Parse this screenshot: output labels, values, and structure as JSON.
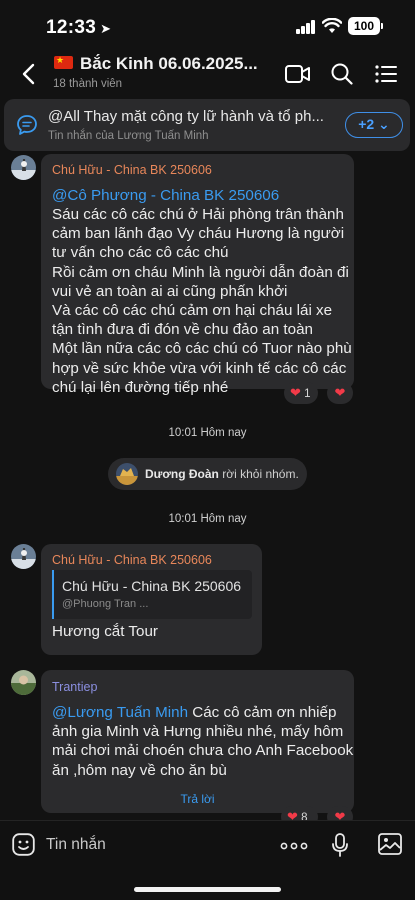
{
  "status_bar": {
    "time": "12:33",
    "battery": "100"
  },
  "header": {
    "title": "Bắc Kinh 06.06.2025...",
    "members": "18 thành viên"
  },
  "pinned": {
    "text": "@All Thay mặt công ty lữ hành và tổ ph...",
    "sub": "Tin nhắn của Lương Tuấn Minh",
    "more": "+2 ⌄"
  },
  "messages": [
    {
      "sender": "Chú Hữu - China BK 250606",
      "sender_color": "#e8875a",
      "mention": "@Cô Phương - China BK 250606",
      "lines": [
        "Sáu các cô các chú ở Hải phòng trân thành",
        "cảm ban lãnh đạo Vy cháu Hương là người",
        "tư vấn cho các cô các chú",
        "Rồi cảm ơn cháu Minh là người dẫn đoàn đi",
        "vui vẻ an toàn ai ai cũng phấn khởi",
        "Và các cô các chú cảm ơn hại cháu lái xe",
        "tận tình đưa đi đón về chu đảo an toàn",
        "Một lần nữa các cô các chú có Tuor nào phù",
        "hợp về sức khỏe vừa với kinh tế các cô các",
        "chú lại lên đường tiếp nhé"
      ],
      "reaction_count": "1"
    },
    {
      "sender": "Chú Hữu - China BK 250606",
      "sender_color": "#e8875a",
      "quote_name": "Chú Hữu - China BK 250606",
      "quote_sub": "@Phuong Tran ...",
      "text": "Hương cắt Tour"
    },
    {
      "sender": "Trantiep",
      "sender_color": "#8b8fe0",
      "mention": "@Lương Tuấn Minh",
      "first_line_rest": " Các cô cảm ơn nhiếp",
      "lines": [
        "ảnh gia Minh và Hưng nhiều nhé, mấy hôm",
        "mải chơi mải choén chưa cho Anh Facebook",
        "ăn  ,hôm nay về cho ăn bù"
      ],
      "reply_label": "Trả lời",
      "reaction_count": "8"
    }
  ],
  "separators": [
    {
      "time": "10:01 Hôm nay"
    },
    {
      "time": "10:01 Hôm nay"
    }
  ],
  "system": {
    "name": "Dương Đoàn",
    "action": " rời khỏi nhóm."
  },
  "input": {
    "placeholder": "Tin nhắn"
  },
  "colors": {
    "accent": "#3a9bf0",
    "bubble": "#2b2b2d",
    "background": "#121212",
    "heart": "#f23a48"
  }
}
